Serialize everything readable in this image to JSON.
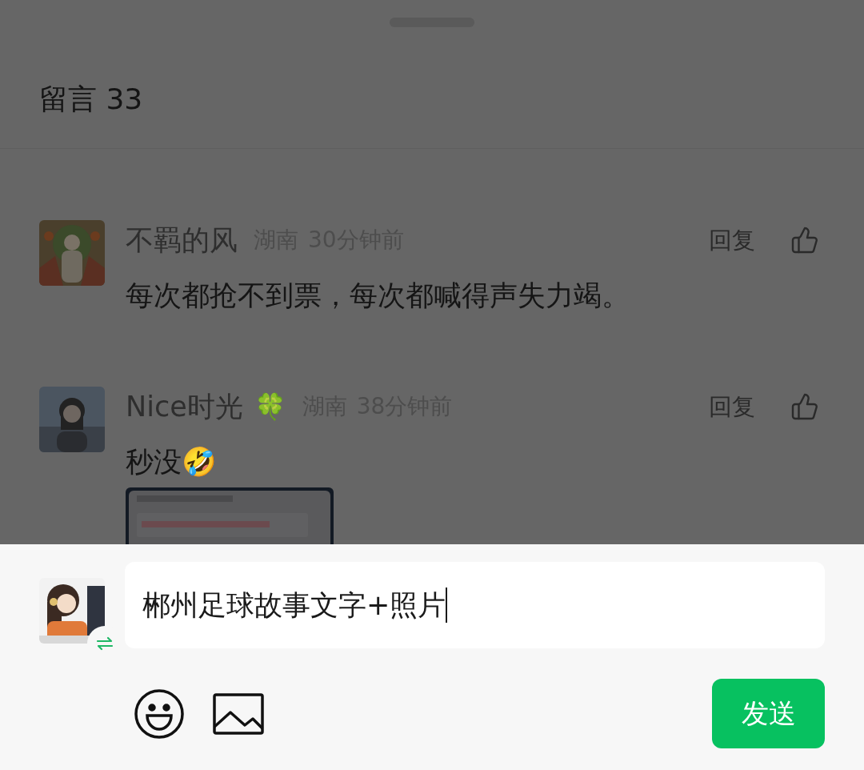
{
  "header": {
    "title": "留言 33"
  },
  "comments": [
    {
      "name": "不羁的风",
      "location": "湖南",
      "time": "30分钟前",
      "reply": "回复",
      "text": "每次都抢不到票，每次都喊得声失力竭。"
    },
    {
      "name": "Nice时光",
      "name_badge": "🍀",
      "location": "湖南",
      "time": "38分钟前",
      "reply": "回复",
      "text": "秒没🤣"
    }
  ],
  "composer": {
    "value": "郴州足球故事文字+照片",
    "send": "发送"
  }
}
